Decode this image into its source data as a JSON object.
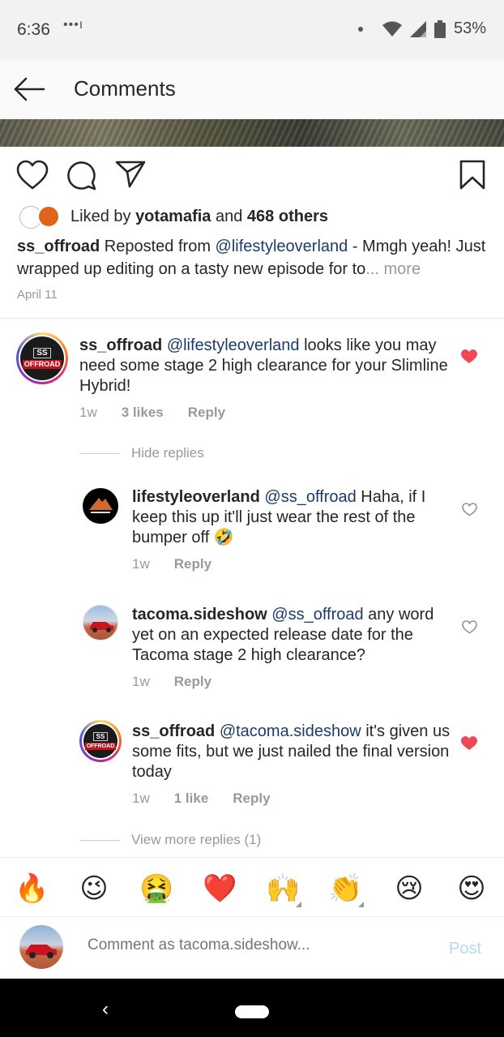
{
  "status_bar": {
    "time": "6:36",
    "battery": "53%"
  },
  "header": {
    "title": "Comments"
  },
  "post": {
    "liked_prefix": "Liked by ",
    "liked_user": "yotamafia",
    "liked_mid": " and ",
    "liked_count": "468 others",
    "caption_user": "ss_offroad",
    "caption_reposted": " Reposted from ",
    "caption_mention": "@lifestyleoverland",
    "caption_text": " -  Mmgh yeah! Just wrapped up editing on a tasty new episode for to",
    "caption_more": "... more",
    "date": "April 11"
  },
  "comments": [
    {
      "user": "ss_offroad",
      "mention": "@lifestyleoverland",
      "text": " looks like you may need some stage 2 high clearance for your Slimline Hybrid!",
      "age": "1w",
      "likes": "3 likes",
      "reply": "Reply",
      "liked": true
    }
  ],
  "hide_replies": "Hide replies",
  "replies": [
    {
      "user": "lifestyleoverland",
      "mention": "@ss_offroad",
      "text": " Haha, if I keep this up it'll just wear the rest of the bumper off 🤣",
      "age": "1w",
      "reply": "Reply"
    },
    {
      "user": "tacoma.sideshow",
      "mention": "@ss_offroad",
      "text": " any word yet on an expected release date for the Tacoma stage 2 high clearance?",
      "age": "1w",
      "reply": "Reply"
    },
    {
      "user": "ss_offroad",
      "mention": "@tacoma.sideshow",
      "text": " it's given us some fits, but we just nailed the final version today",
      "age": "1w",
      "likes": "1 like",
      "reply": "Reply"
    }
  ],
  "view_more": "View more replies (1)",
  "emoji_bar": [
    "🔥",
    "😉",
    "🤮",
    "❤️",
    "🙌",
    "👏",
    "😢",
    "😍"
  ],
  "composer": {
    "placeholder": "Comment as tacoma.sideshow...",
    "post_label": "Post"
  },
  "logo_text": {
    "ss_top": "SS",
    "ss_bottom": "OFFROAD"
  },
  "colors": {
    "heart": "#ed4956",
    "mention": "#1c3b6c",
    "post": "#b6d8f5"
  }
}
